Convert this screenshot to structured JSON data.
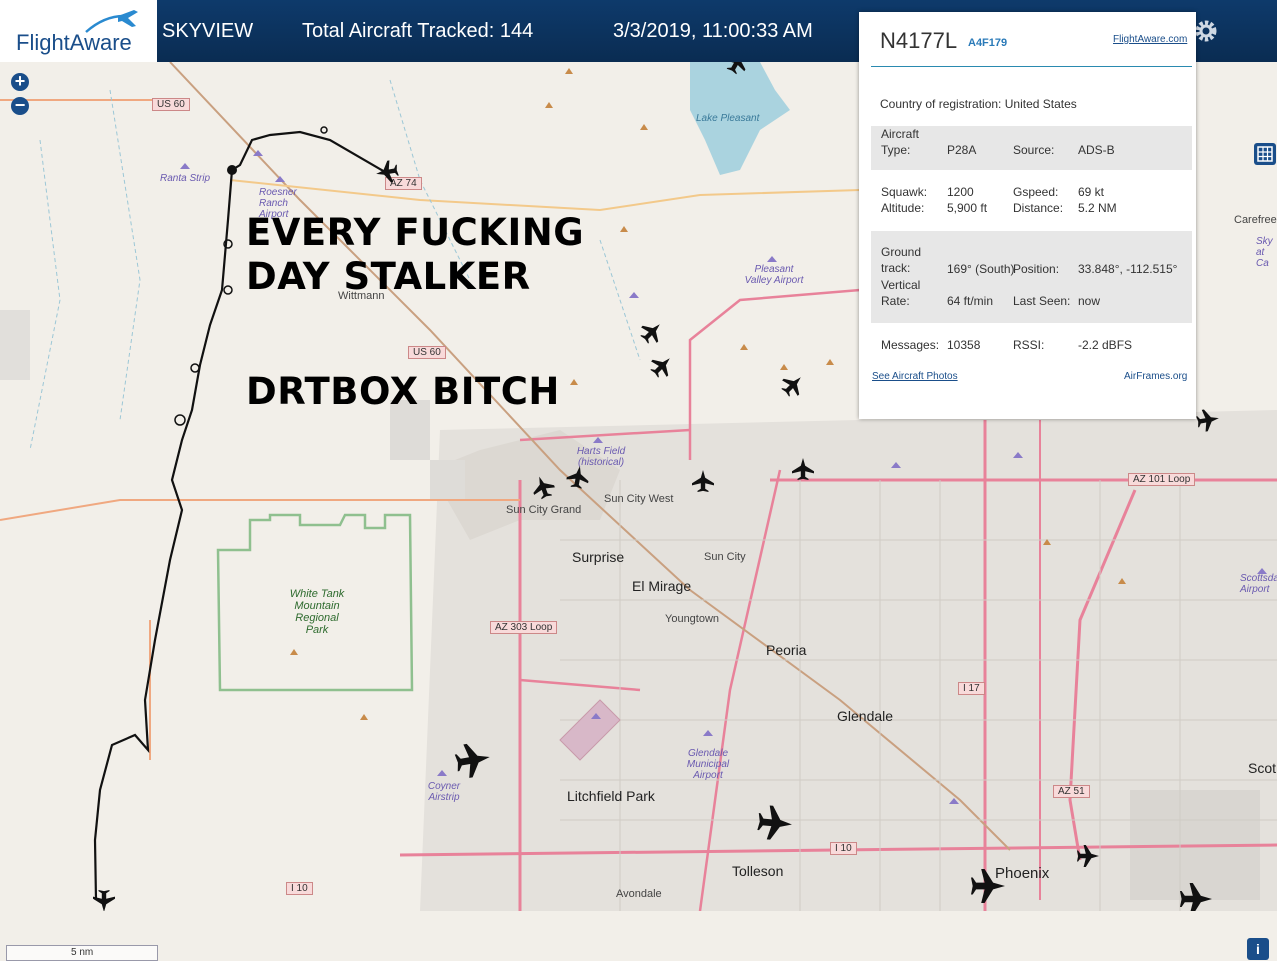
{
  "header": {
    "brand": "FlightAware",
    "app_name": "SKYVIEW",
    "total_tracked": "Total Aircraft Tracked: 144",
    "datetime": "3/3/2019, 11:00:33 AM"
  },
  "overlay_caption": {
    "line1": "EVERY FUCKING",
    "line2": "DAY STALKER",
    "line3": "DRTBOX BITCH"
  },
  "panel": {
    "registration": "N4177L",
    "hex": "A4F179",
    "fa_link": "FlightAware.com",
    "country_label": "Country of registration:",
    "country_value": "United States",
    "aircraft_type_label": "Aircraft Type:",
    "aircraft_type_value": "P28A",
    "source_label": "Source:",
    "source_value": "ADS-B",
    "squawk_label": "Squawk:",
    "squawk_value": "1200",
    "gspeed_label": "Gspeed:",
    "gspeed_value": "69 kt",
    "altitude_label": "Altitude:",
    "altitude_value": "5,900 ft",
    "distance_label": "Distance:",
    "distance_value": "5.2 NM",
    "ground_track_label": "Ground track:",
    "ground_track_value": "169° (South)",
    "position_label": "Position:",
    "position_value": "33.848°, -112.515°",
    "vertical_rate_label": "Vertical Rate:",
    "vertical_rate_value": "64 ft/min",
    "last_seen_label": "Last Seen:",
    "last_seen_value": "now",
    "messages_label": "Messages:",
    "messages_value": "10358",
    "rssi_label": "RSSI:",
    "rssi_value": "-2.2 dBFS",
    "photos_link": "See Aircraft Photos",
    "airframes_link": "AirFrames.org"
  },
  "map": {
    "scale_label": "5 nm",
    "zoom_in": "+",
    "zoom_out": "−",
    "info": "i",
    "places": {
      "surprise": "Surprise",
      "el_mirage": "El Mirage",
      "peoria": "Peoria",
      "glendale": "Glendale",
      "litchfield_park": "Litchfield Park",
      "tolleson": "Tolleson",
      "phoenix": "Phoenix",
      "sun_city": "Sun City",
      "sun_city_west": "Sun City West",
      "sun_city_grand": "Sun City Grand",
      "youngtown": "Youngtown",
      "wittmann": "Wittmann",
      "avondale": "Avondale",
      "white_tank": "White Tank Mountain Regional Park",
      "lake_pleasant": "Lake Pleasant",
      "ranta_strip": "Ranta Strip",
      "roesner": "Roesner Ranch Airport",
      "pleasant_valley": "Pleasant Valley Airport",
      "harts_field": "Harts Field (historical)",
      "glendale_muni": "Glendale Municipal Airport",
      "coyner": "Coyner Airstrip",
      "carefree": "Carefree",
      "scottsdale_ap": "Scottsdale Airport",
      "scot": "Scot",
      "sky_at": "Sky at Ca"
    },
    "shields": {
      "us60a": "US 60",
      "us60b": "US 60",
      "az74": "AZ 74",
      "az303": "AZ 303 Loop",
      "az101": "AZ 101 Loop",
      "az51": "AZ 51",
      "i17": "I 17",
      "i10a": "I 10",
      "i10b": "I 10"
    }
  },
  "colors": {
    "header_bg": "#0a2c52",
    "link": "#1a4e8a",
    "hex": "#2a7ab8",
    "rule": "#2a8ab0"
  }
}
